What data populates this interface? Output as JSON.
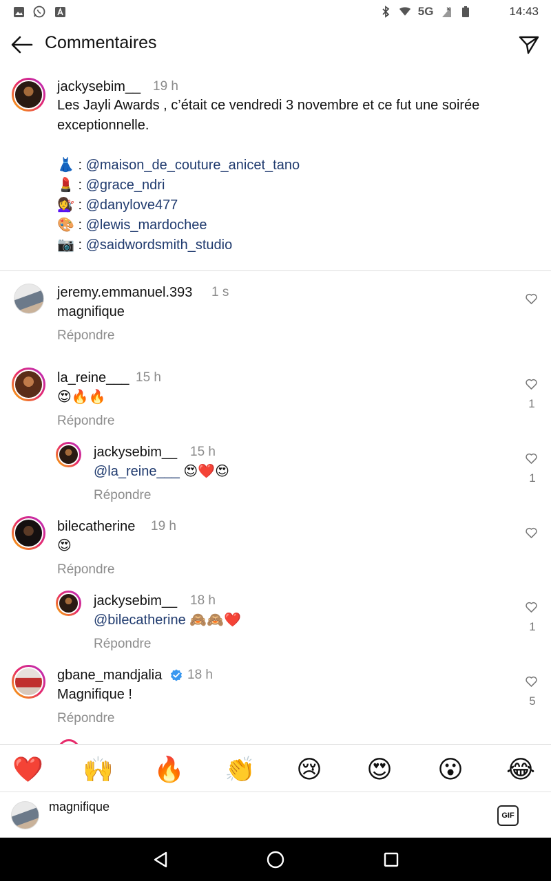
{
  "status_bar": {
    "time": "14:43",
    "network": "5G",
    "left_icons": [
      "image-icon",
      "whatsapp-icon",
      "a-icon"
    ],
    "right_icons": [
      "bluetooth-icon",
      "signal-icon",
      "battery-icon"
    ]
  },
  "header": {
    "title": "Commentaires"
  },
  "caption": {
    "username": "jackysebim__",
    "time": "19 h",
    "text_line1": "Les Jayli Awards , c’était ce vendredi 3 novembre et ce fut une soirée",
    "text_line2": "exceptionnelle.",
    "credits": [
      {
        "emoji": "👗",
        "sep": " : ",
        "mention": "@maison_de_couture_anicet_tano"
      },
      {
        "emoji": "💄",
        "sep": " : ",
        "mention": "@grace_ndri"
      },
      {
        "emoji": "💇‍♀️",
        "sep": " : ",
        "mention": "@danylove477"
      },
      {
        "emoji": "🎨",
        "sep": " : ",
        "mention": "@lewis_mardochee"
      },
      {
        "emoji": "📷",
        "sep": " : ",
        "mention": "@saidwordsmith_studio"
      }
    ]
  },
  "comments": [
    {
      "username": "jeremy.emmanuel.393",
      "time": "1 s",
      "text": "magnifique",
      "reply": "Répondre",
      "likes": ""
    },
    {
      "username": "la_reine___",
      "time": "15 h",
      "text": "😍🔥🔥",
      "reply": "Répondre",
      "likes": "1"
    },
    {
      "username": "jackysebim__",
      "time": "15 h",
      "mention": "@la_reine___",
      "text": " 😍❤️😍",
      "reply": "Répondre",
      "likes": "1"
    },
    {
      "username": "bilecatherine",
      "time": "19 h",
      "text": "😍",
      "reply": "Répondre",
      "likes": ""
    },
    {
      "username": "jackysebim__",
      "time": "18 h",
      "mention": "@bilecatherine",
      "text": " 🙈🙈❤️",
      "reply": "Répondre",
      "likes": "1"
    },
    {
      "username": "gbane_mandjalia",
      "time": "18 h",
      "text": "Magnifique !",
      "reply": "Répondre",
      "likes": "5",
      "verified": true
    }
  ],
  "emoji_bar": [
    "❤️",
    "🙌",
    "🔥",
    "👏",
    "😢",
    "😍",
    "😮",
    "😂"
  ],
  "input": {
    "value": "magnifique",
    "gif_label": "GIF"
  },
  "colors": {
    "mention": "#1f3a6e",
    "muted": "#8c8c8c",
    "verified": "#3897f0"
  }
}
